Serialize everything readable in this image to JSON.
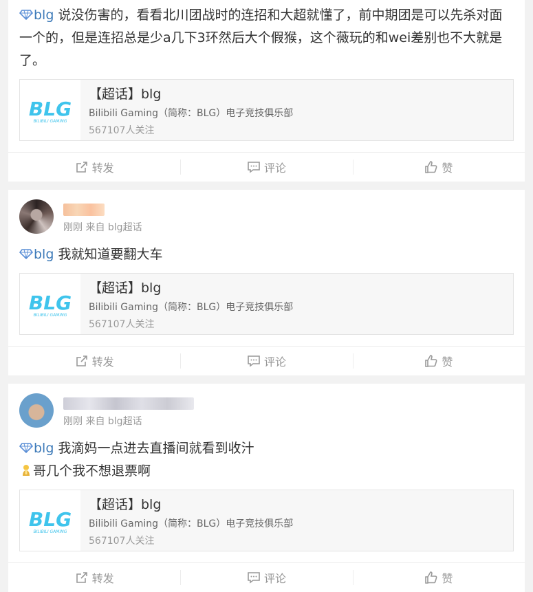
{
  "colors": {
    "tag": "#3d7ab8",
    "meta": "#999999",
    "bg": "#f2f2f2",
    "logo": "#3fc4ec"
  },
  "topic_card": {
    "title": "【超话】blg",
    "description": "Bilibili Gaming（简称：BLG）电子竞技俱乐部",
    "fans": "567107人关注",
    "logo_text": "BLG",
    "logo_sub": "BILIBILI GAMING"
  },
  "actions": {
    "repost": "转发",
    "comment": "评论",
    "like": "赞"
  },
  "posts": [
    {
      "tag": "blg",
      "text": " 说没伤害的，看看北川团战时的连招和大超就懂了，前中期团是可以先杀对面一个的，但是连招总是少a几下3环然后大个假猴，这个薇玩的和wei差别也不大就是了。"
    },
    {
      "meta": "刚刚 来自 blg超话",
      "tag": "blg",
      "text": " 我就知道要翻大车"
    },
    {
      "meta": "刚刚 来自 blg超话",
      "tag": "blg",
      "text": " 我滴妈一点进去直播间就看到收汁",
      "text2": "哥几个我不想退票啊"
    }
  ]
}
